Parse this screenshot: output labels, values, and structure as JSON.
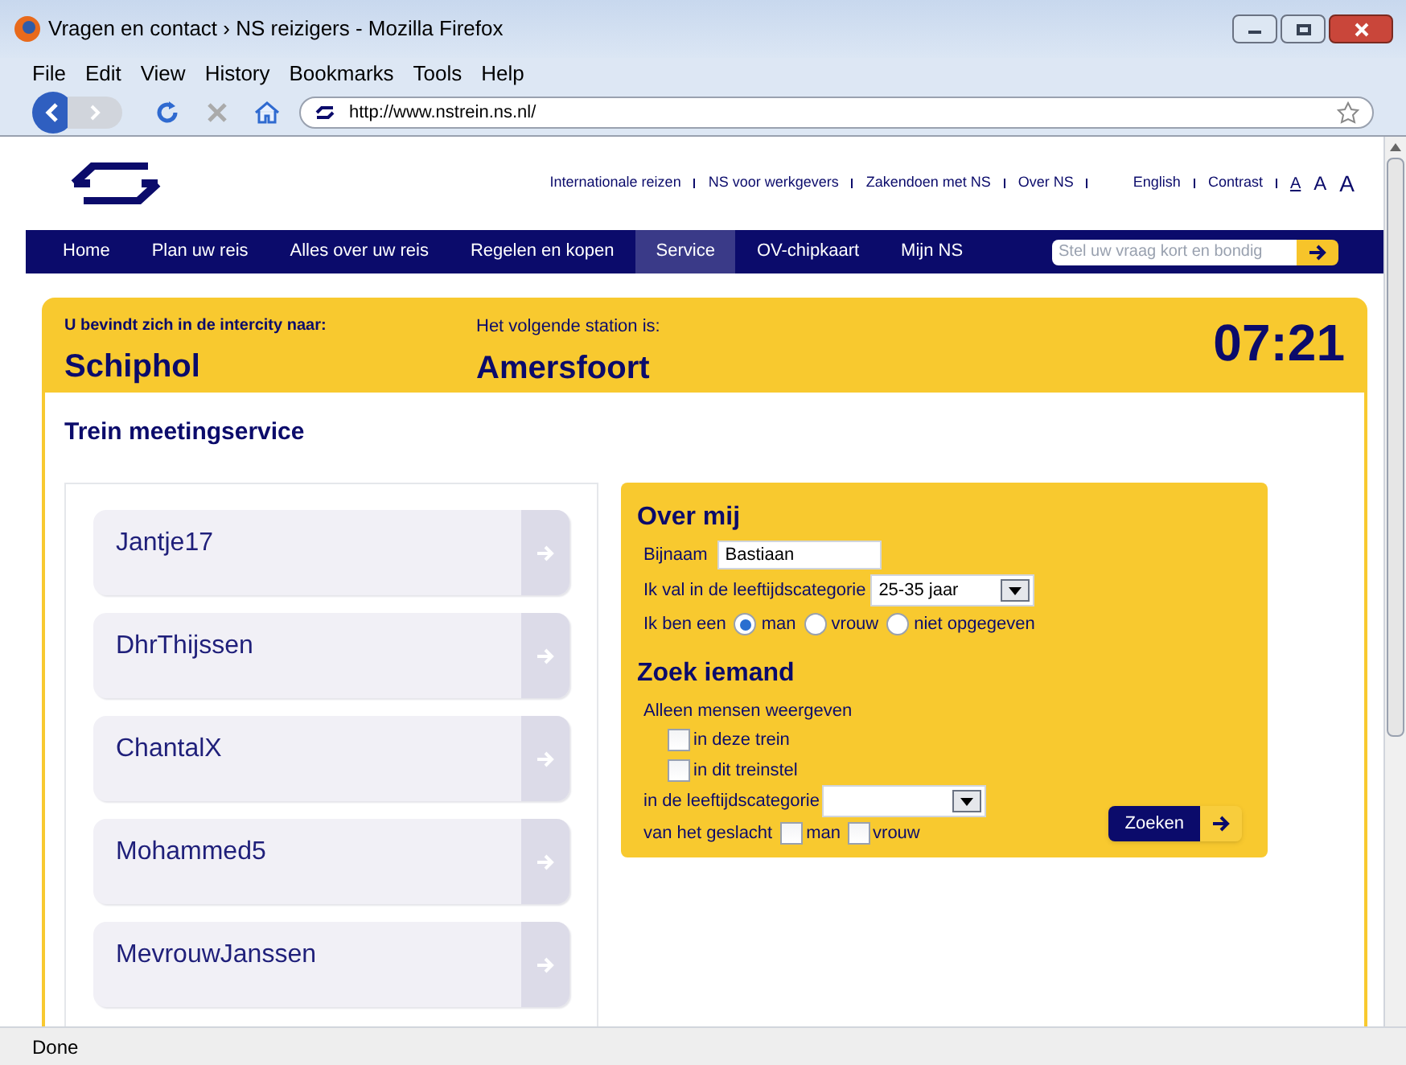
{
  "window": {
    "title": "Vragen en contact › NS reizigers - Mozilla Firefox"
  },
  "menu": [
    "File",
    "Edit",
    "View",
    "History",
    "Bookmarks",
    "Tools",
    "Help"
  ],
  "address": {
    "value": "http://www.nstrein.ns.nl/"
  },
  "top_links": [
    "Internationale reizen",
    "NS voor werkgevers",
    "Zakendoen met NS",
    "Over NS"
  ],
  "lang_links": [
    "English",
    "Contrast"
  ],
  "font_sizes": [
    "A",
    "A",
    "A"
  ],
  "nav": [
    {
      "label": "Home",
      "selected": false
    },
    {
      "label": "Plan uw reis",
      "selected": false
    },
    {
      "label": "Alles over uw reis",
      "selected": false
    },
    {
      "label": "Regelen en kopen",
      "selected": false
    },
    {
      "label": "Service",
      "selected": true
    },
    {
      "label": "OV-chipkaart",
      "selected": false
    },
    {
      "label": "Mijn NS",
      "selected": false
    }
  ],
  "search": {
    "placeholder": "Stel uw vraag kort en bondig"
  },
  "train": {
    "destination_label": "U bevindt zich in de intercity naar:",
    "destination": "Schiphol",
    "next_label": "Het volgende station is:",
    "next": "Amersfoort",
    "time": "07:21"
  },
  "heading": "Trein meetingservice",
  "people": [
    "Jantje17",
    "DhrThijssen",
    "ChantalX",
    "Mohammed5",
    "MevrouwJanssen"
  ],
  "about": {
    "title": "Over mij",
    "nickname_label": "Bijnaam",
    "nickname": "Bastiaan",
    "age_label": "Ik val in de leeftijdscategorie",
    "age": "25-35 jaar",
    "gender_label": "Ik ben een",
    "genders": [
      {
        "label": "man",
        "selected": true
      },
      {
        "label": "vrouw",
        "selected": false
      },
      {
        "label": "niet opgegeven",
        "selected": false
      }
    ]
  },
  "find": {
    "title": "Zoek iemand",
    "only_label": "Alleen mensen weergeven",
    "options": [
      {
        "label": "in deze trein",
        "checked": false
      },
      {
        "label": "in dit treinstel",
        "checked": false
      }
    ],
    "age_label": "in de leeftijdscategorie",
    "gender_label": "van het geslacht",
    "genders": [
      {
        "label": "man",
        "checked": false
      },
      {
        "label": "vrouw",
        "checked": false
      }
    ],
    "button": "Zoeken"
  },
  "status_bar": "Done"
}
